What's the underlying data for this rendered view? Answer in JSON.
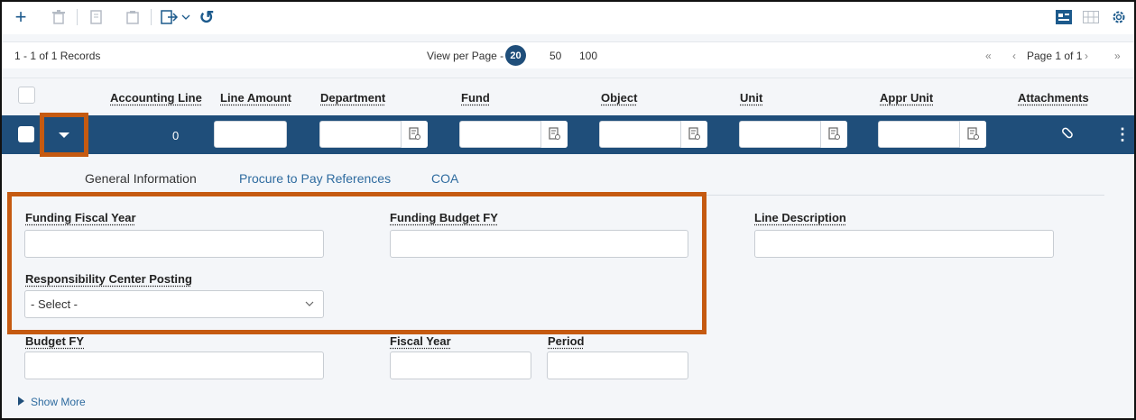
{
  "toolbar": {
    "icons": [
      "add-icon",
      "delete-icon",
      "copy-icon",
      "paste-icon",
      "export-icon",
      "undo-icon"
    ],
    "add_glyph": "+",
    "undo_glyph": "↺"
  },
  "records": {
    "count": "1 - 1 of 1 Records",
    "view_per_page_label": "View per Page -",
    "page_sizes": [
      "20",
      "50",
      "100"
    ],
    "page_label": "Page 1 of 1"
  },
  "columns": [
    "Accounting Line",
    "Line Amount",
    "Department",
    "Fund",
    "Object",
    "Unit",
    "Appr Unit",
    "Attachments"
  ],
  "row": {
    "accounting_line": "0",
    "line_amount": "",
    "department": "",
    "fund": "",
    "object": "",
    "unit": "",
    "appr_unit": ""
  },
  "tabs": [
    "General Information",
    "Procure to Pay References",
    "COA"
  ],
  "form": {
    "funding_fiscal_year_label": "Funding Fiscal Year",
    "funding_budget_fy_label": "Funding Budget FY",
    "line_description_label": "Line Description",
    "responsibility_center_posting_label": "Responsibility Center Posting",
    "responsibility_center_posting_value": "- Select -",
    "budget_fy_label": "Budget FY",
    "fiscal_year_label": "Fiscal Year",
    "period_label": "Period"
  },
  "show_more": "Show More",
  "colors": {
    "brand_blue": "#1f4e7a",
    "highlight_orange": "#c55a11",
    "link_blue": "#2e6b9f"
  }
}
